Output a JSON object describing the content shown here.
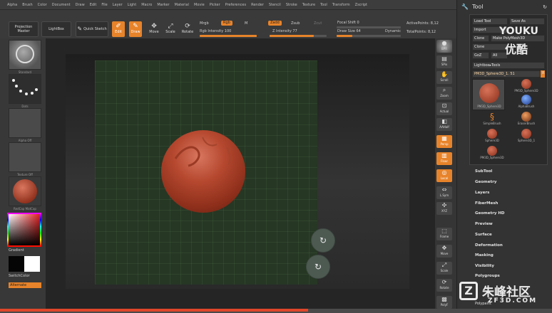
{
  "menu": [
    "Alpha",
    "Brush",
    "Color",
    "Document",
    "Draw",
    "Edit",
    "File",
    "Layer",
    "Light",
    "Macro",
    "Marker",
    "Material",
    "Movie",
    "Picker",
    "Preferences",
    "Render",
    "Stencil",
    "Stroke",
    "Texture",
    "Tool",
    "Transform",
    "Zscript"
  ],
  "shelf": {
    "projection_master": "Projection Master",
    "lightbox": "LightBox",
    "quick_sketch": "Quick Sketch",
    "edit": "Edit",
    "draw": "Draw",
    "move": "Move",
    "scale": "Scale",
    "rotate": "Rotate",
    "mrgb": "Mrgb",
    "rgb": "Rgb",
    "m": "M",
    "rgb_intensity": "Rgb Intensity 100",
    "zadd": "Zadd",
    "zsub": "Zsub",
    "zcut": "Zcut",
    "z_intensity": "Z Intensity 77",
    "focal_shift": "Focal Shift 0",
    "draw_size": "Draw Size 64",
    "dynamic": "Dynamic",
    "active_points": "ActivePoints: 8,12",
    "total_points": "TotalPoints: 8,12"
  },
  "left_tray": {
    "brush_label": "Standard",
    "stroke_label": "Dots",
    "alpha_label": "Alpha Off",
    "texture_label": "Texture Off",
    "material_label": "RedCap MatCap",
    "gradient_label": "Gradient",
    "switch_color_label": "SwitchColor",
    "alternate_label": "Alternate"
  },
  "right_shelf": [
    "BPR",
    "SPix",
    "Scroll",
    "Zoom",
    "Actual",
    "AAHalf",
    "Persp",
    "Floor",
    "Local",
    "L.Sym",
    "XYZ",
    "Frame",
    "Move",
    "Scale",
    "Rotate",
    "PolyF"
  ],
  "tool_panel": {
    "title": "Tool",
    "load_tool": "Load Tool",
    "save_as": "Save As",
    "import": "Import",
    "clone": "Clone",
    "make_polymesh": "Make PolyMesh3D",
    "goz": "GoZ",
    "all": "All",
    "visible": "Visible",
    "r": "R",
    "lightbox_tools": "Lightbox▸Tools",
    "current_tool": "PM3D_Sphere3D_1. 51",
    "tools": [
      "PM3D_Sphere3D",
      "PM3D_Sphere3D",
      "AlphaBrush",
      "SimpleBrush",
      "EraserBrush",
      "Sphere3D",
      "Sphere3D_1",
      "PM3D_Sphere3D"
    ],
    "subpalettes": [
      "SubTool",
      "Geometry",
      "Layers",
      "FiberMesh",
      "Geometry HD",
      "Preview",
      "Surface",
      "Deformation",
      "Masking",
      "Visibility",
      "Polygroups"
    ],
    "polypaint": "Polypaint"
  },
  "watermarks": {
    "youku_en": "YOUKU",
    "youku_cn": "优酷",
    "site_cn": "朱峰社区",
    "site_url": "ZF3D.COM"
  },
  "colors": {
    "accent": "#e7832a",
    "clay": "#b5482f",
    "grid": "#263724"
  }
}
